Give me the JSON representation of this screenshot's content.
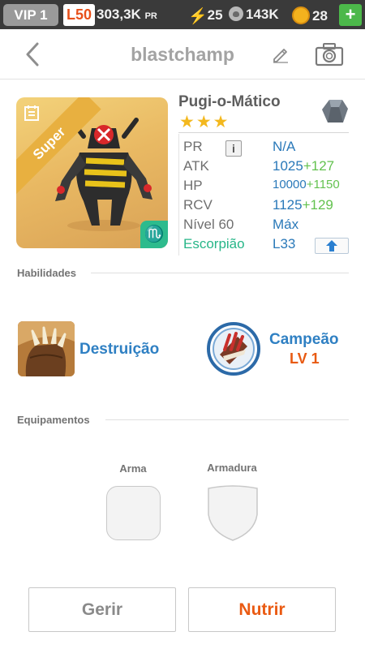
{
  "status_bar": {
    "vip": "VIP 1",
    "level": "L50",
    "power": "303,3K",
    "power_unit": "PR",
    "energy": "25",
    "stamina": "143K",
    "coins": "28",
    "plus": "+",
    "icons": [
      "bolt-icon",
      "paw-icon",
      "coin-icon",
      "plus-icon"
    ],
    "colors": {
      "bar": "#3a3a3a",
      "level": "#e8501a",
      "plus": "#4cb84a"
    }
  },
  "header": {
    "title": "blastchamp",
    "icons": [
      "back-arrow-icon",
      "pencil-icon",
      "camera-icon"
    ]
  },
  "monster": {
    "card_badge": "Super",
    "zodiac_symbol": "♏",
    "name": "Pugi-o-Mático",
    "stars": "★★★",
    "element_icon": "rock-element-icon",
    "info_button": "i",
    "stats": {
      "pr_label": "PR",
      "pr_value": "N/A",
      "atk_label": "ATK",
      "atk_value": "1025",
      "atk_bonus": "+127",
      "hp_label": "HP",
      "hp_value": "10000",
      "hp_bonus": "+1150",
      "rcv_label": "RCV",
      "rcv_value": "1125",
      "rcv_bonus": "+129",
      "level_label": "Nível 60",
      "level_value": "Máx",
      "zodiac_label": "Escorpião",
      "zodiac_level": "L33"
    },
    "colors": {
      "stat_value": "#2a79b9",
      "bonus": "#63c24f",
      "zodiac": "#27b688"
    }
  },
  "abilities": {
    "section_label": "Habilidades",
    "skill_1": {
      "name": "Destruição",
      "icon": "claw-skill-icon"
    },
    "skill_2": {
      "name": "Campeão",
      "level": "LV 1",
      "icon": "champion-badge-icon"
    }
  },
  "equipment": {
    "section_label": "Equipamentos",
    "weapon_label": "Arma",
    "armor_label": "Armadura"
  },
  "buttons": {
    "manage": "Gerir",
    "feed": "Nutrir"
  }
}
